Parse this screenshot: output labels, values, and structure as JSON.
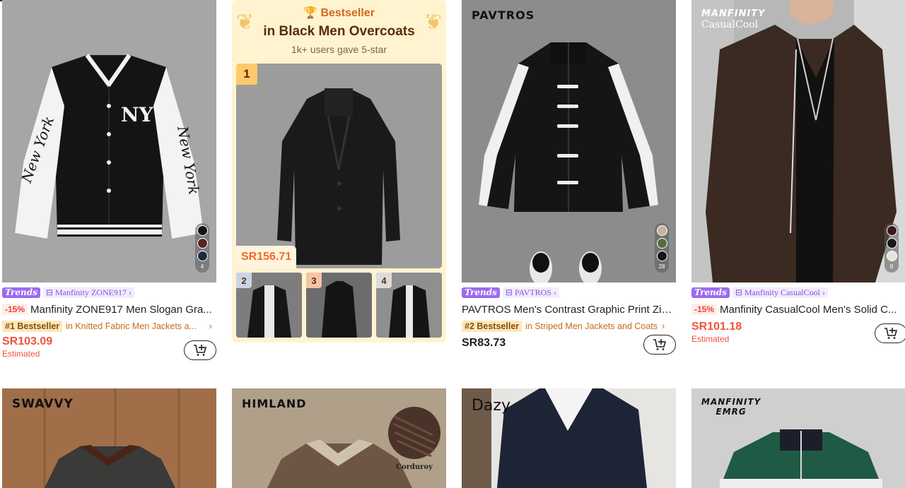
{
  "products": [
    {
      "trend_label": "Trends",
      "store": "Manfinity ZONE917",
      "discount": "-15%",
      "title": "Manfinity ZONE917 Men Slogan Gra...",
      "bestseller_tag": "#1 Bestseller",
      "bestseller_in": "in Knitted Fabric Men Jackets a...",
      "price": "SR103.09",
      "price_note": "Estimated",
      "swatch_count": "4",
      "swatches": [
        "#111111",
        "#5a2324",
        "#1e2b3f"
      ]
    },
    {
      "brand_mark": "PAVTROS",
      "trend_label": "Trends",
      "store": "PAVTROS",
      "title": "PAVTROS Men's Contrast Graphic Print Zip...",
      "bestseller_tag": "#2 Bestseller",
      "bestseller_in": "in Striped Men Jackets and Coats",
      "price": "SR83.73",
      "swatch_count": "28",
      "swatches": [
        "#c9b3a1",
        "#556b42",
        "#141414"
      ]
    },
    {
      "brand_mark": "MANFINITY",
      "brand_sub": "CasualCool",
      "trend_label": "Trends",
      "store": "Manfinity CasualCool",
      "discount": "-15%",
      "title": "Manfinity CasualCool Men's Solid C...",
      "price": "SR101.18",
      "price_note": "Estimated",
      "swatch_count": "8",
      "swatches": [
        "#3b1a1e",
        "#181818",
        "#e8e4dc"
      ]
    }
  ],
  "promo": {
    "top_label": "Bestseller",
    "title": "in Black Men Overcoats",
    "subtitle": "1k+ users gave 5-star",
    "main_rank": "1",
    "main_price": "SR156.71",
    "thumb_ranks": [
      "2",
      "3",
      "4"
    ]
  },
  "row2": {
    "brands": [
      "SWAVVY",
      "HIMLAND",
      "Dazy",
      "MANFINITY",
      "EMRG"
    ],
    "badge": "Corduroy"
  },
  "colors": {
    "accent_price": "#f0533b",
    "trend_purple": "#9b6bf0",
    "promo_bg": "#fff3d0"
  },
  "icons": [
    "store-icon",
    "cart-plus-icon",
    "trophy-icon",
    "laurel-icon",
    "chevron-right-icon"
  ]
}
